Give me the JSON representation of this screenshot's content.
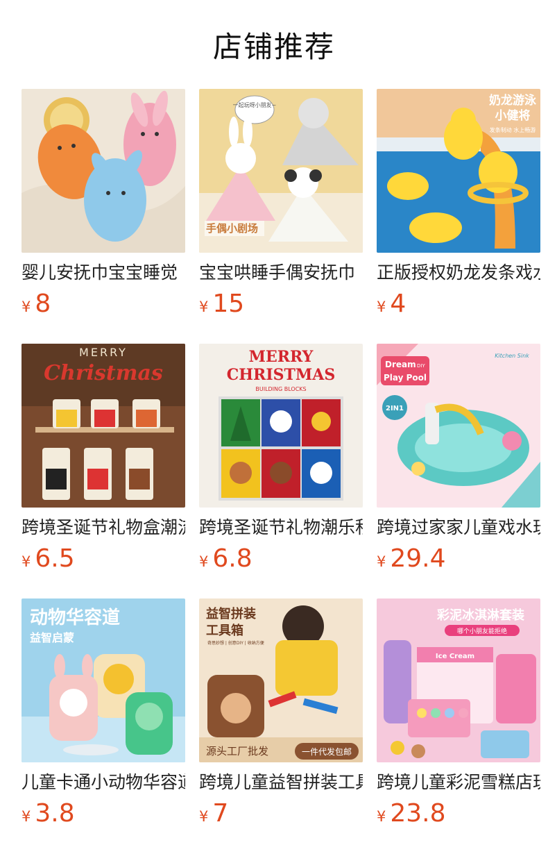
{
  "header": {
    "title": "店铺推荐"
  },
  "products": [
    {
      "name": "婴儿安抚巾宝宝睡觉",
      "currency": "¥",
      "price": "8",
      "icon": "plush-bunny-comforter-image",
      "image_text": []
    },
    {
      "name": "宝宝哄睡手偶安抚巾",
      "currency": "¥",
      "price": "15",
      "icon": "hand-puppet-comforter-image",
      "image_text": [
        "一起玩呀小朋友~",
        "手偶小剧场"
      ]
    },
    {
      "name": "正版授权奶龙发条戏水",
      "currency": "¥",
      "price": "4",
      "icon": "yellow-duck-bath-toy-image",
      "image_text": [
        "奶龙游泳",
        "小健将",
        "发条制动 水上畅游"
      ]
    },
    {
      "name": "跨境圣诞节礼物盒潮流",
      "currency": "¥",
      "price": "6.5",
      "icon": "christmas-block-gift-box-image",
      "image_text": [
        "MERRY",
        "Christmas"
      ]
    },
    {
      "name": "跨境圣诞节礼物潮乐积",
      "currency": "¥",
      "price": "6.8",
      "icon": "christmas-building-blocks-image",
      "image_text": [
        "MERRY",
        "CHRISTMAS",
        "BUILDING BLOCKS"
      ]
    },
    {
      "name": "跨境过家家儿童戏水玩",
      "currency": "¥",
      "price": "29.4",
      "icon": "play-pool-kitchen-toy-image",
      "image_text": [
        "Dream",
        "DIY",
        "Play Pool",
        "Kitchen Sink",
        "2IN1"
      ]
    },
    {
      "name": "儿童卡通小动物华容道",
      "currency": "¥",
      "price": "3.8",
      "icon": "animal-slide-puzzle-image",
      "image_text": [
        "动物华容道",
        "益智启蒙"
      ]
    },
    {
      "name": "跨境儿童益智拼装工具",
      "currency": "¥",
      "price": "7",
      "icon": "assembly-tool-box-image",
      "image_text": [
        "益智拼装",
        "工具箱",
        "奇思妙想 | 创意DIY | 收纳方便",
        "源头工厂批发",
        "一件代发包邮"
      ]
    },
    {
      "name": "跨境儿童彩泥雪糕店玩",
      "currency": "¥",
      "price": "23.8",
      "icon": "clay-ice-cream-shop-image",
      "image_text": [
        "彩泥冰淇淋套装",
        "哪个小朋友能拒绝",
        "Ice Cream"
      ]
    }
  ]
}
